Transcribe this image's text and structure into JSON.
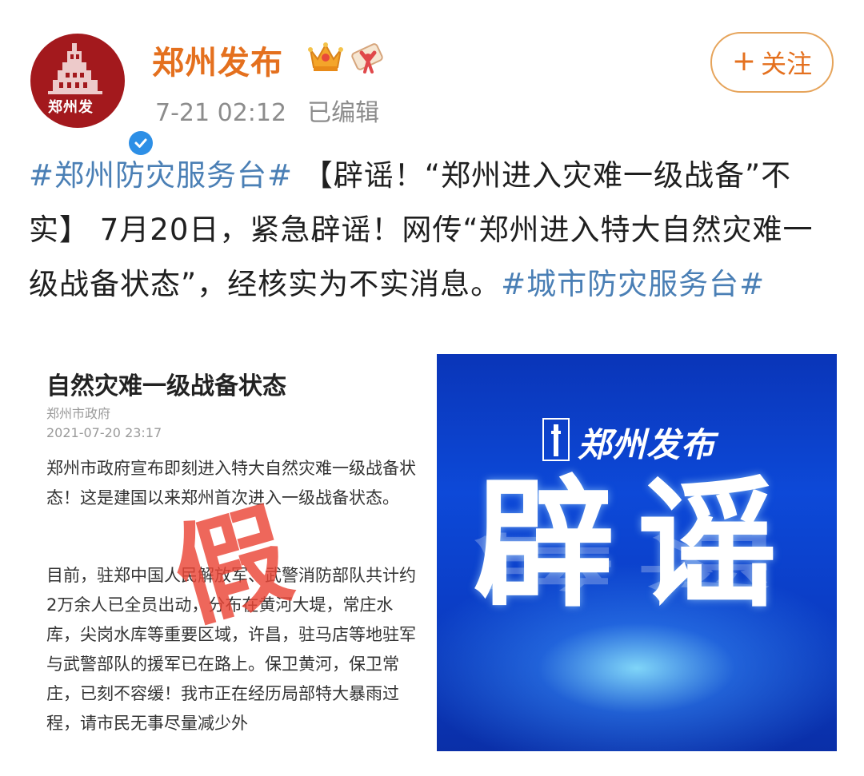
{
  "header": {
    "account_name": "郑州发布",
    "avatar_label": "郑州发",
    "timestamp": "7-21 02:12",
    "edited_label": "已编辑",
    "follow_plus": "+",
    "follow_label": "关注",
    "icons": [
      "avatar",
      "verified-badge-icon",
      "crown-icon",
      "scroll-icon"
    ]
  },
  "post": {
    "topic_1": "#郑州防灾服务台#",
    "body": "【辟谣！“郑州进入灾难一级战备”不实】 7月20日，紧急辟谣！网传“郑州进入特大自然灾难一级战备状态”，经核实为不实消息。",
    "topic_2": "#城市防灾服务台#"
  },
  "left_image": {
    "title": "自然灾难一级战备状态",
    "source": "郑州市政府",
    "time": "2021-07-20 23:17",
    "para_1": "郑州市政府宣布即刻进入特大自然灾难一级战备状态！这是建国以来郑州首次进入一级战备状态。",
    "para_2": "目前，驻郑中国人民解放军、武警消防部队共计约2万余人已全员出动，分布在黄河大堤，常庄水库，尖岗水库等重要区域，许昌，驻马店等地驻军与武警部队的援军已在路上。保卫黄河，保卫常庄，已刻不容缓！我市正在经历局部特大暴雨过程，请市民无事尽量减少外",
    "stamp": "假"
  },
  "right_image": {
    "logo_text": "郑州发布",
    "headline": "辟谣"
  },
  "colors": {
    "account_name": "#e4701e",
    "topic_link": "#4a7fb5",
    "avatar_bg": "#a3191d",
    "banner_blue": "#0d49d8",
    "stamp_red": "#ea4637"
  }
}
